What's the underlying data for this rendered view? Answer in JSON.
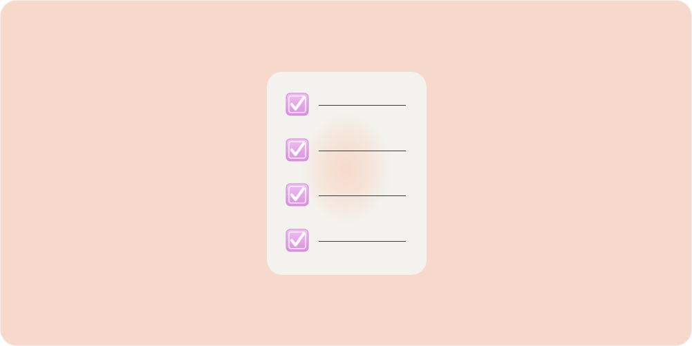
{
  "illustration": {
    "background_color": "#f6d9cb",
    "card_color": "#f4f2ee",
    "checkbox_color": "#e4a6e9",
    "line_color": "#3a3a3a",
    "items": [
      {
        "icon": "checked-box-icon",
        "checked": true
      },
      {
        "icon": "checked-box-icon",
        "checked": true
      },
      {
        "icon": "checked-box-icon",
        "checked": true
      },
      {
        "icon": "checked-box-icon",
        "checked": true
      }
    ]
  }
}
